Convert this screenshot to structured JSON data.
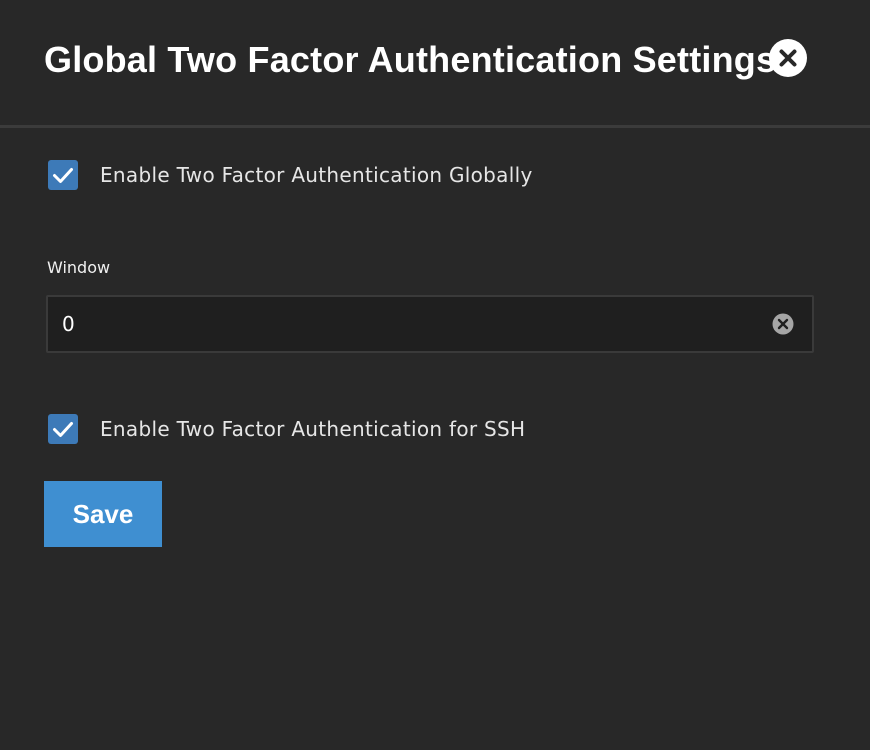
{
  "dialog": {
    "title": "Global Two Factor Authentication Settings",
    "close_icon": "close-circle-icon"
  },
  "form": {
    "enable_globally": {
      "label": "Enable Two Factor Authentication Globally",
      "checked": true
    },
    "window": {
      "label": "Window",
      "value": "0",
      "clear_icon": "clear-circle-icon"
    },
    "enable_ssh": {
      "label": "Enable Two Factor Authentication for SSH",
      "checked": true
    },
    "save_label": "Save"
  },
  "colors": {
    "background": "#282828",
    "accent": "#3f8fd1",
    "checkbox": "#3d7ab8",
    "input_background": "#1f1f1f"
  }
}
